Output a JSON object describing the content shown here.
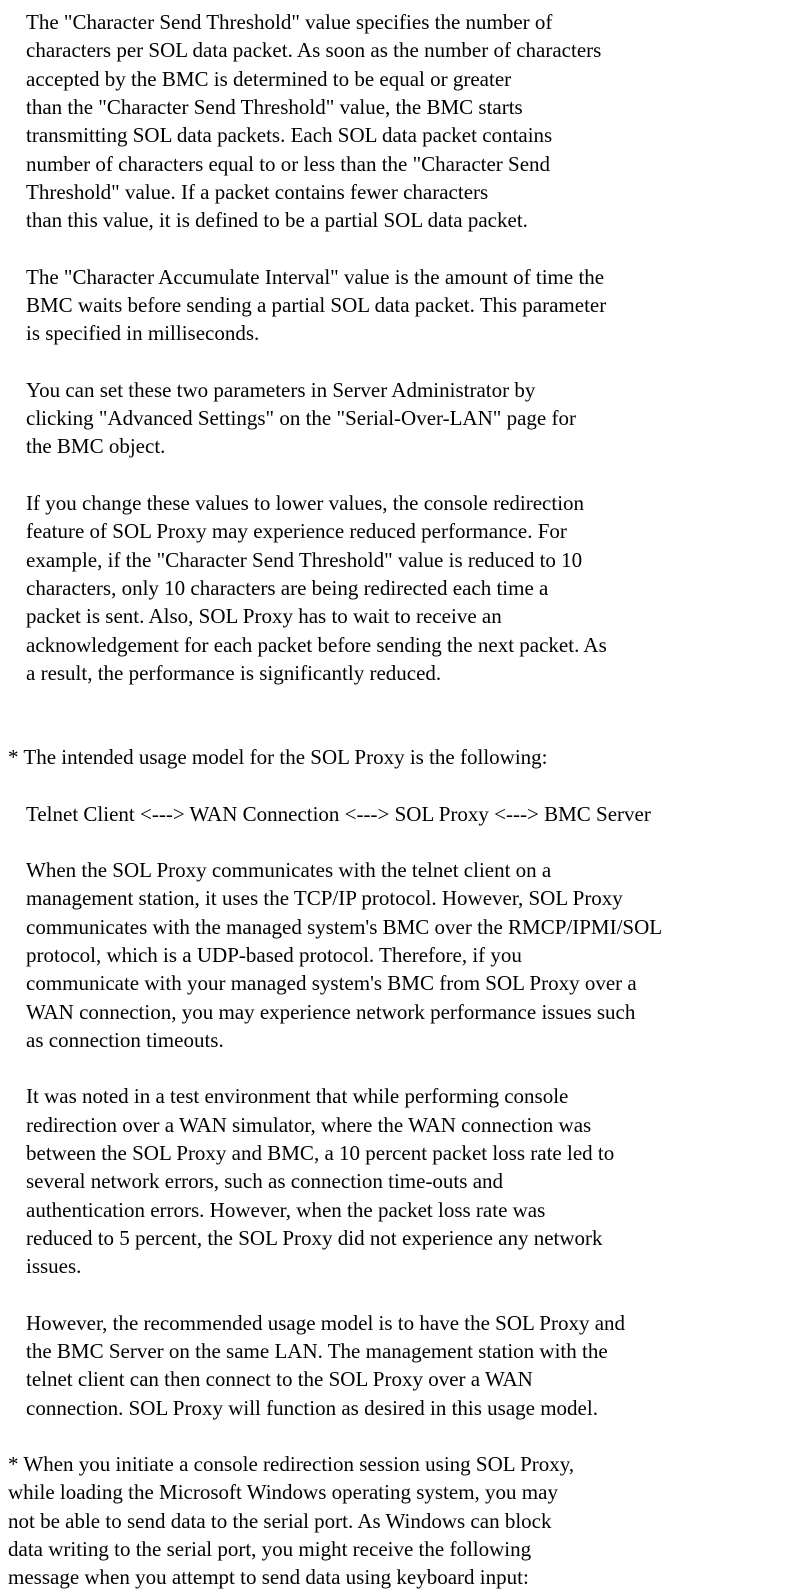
{
  "p1": {
    "l1": "The \"Character Send Threshold\" value specifies the number of",
    "l2": "characters per SOL data packet. As soon as the number of characters",
    "l3": "accepted by the BMC is determined to be equal or greater",
    "l4": "than the \"Character Send Threshold\" value, the BMC starts",
    "l5": "transmitting SOL data packets. Each SOL data packet contains",
    "l6": "number of characters equal to or less than the \"Character Send",
    "l7": "Threshold\" value. If a packet contains fewer characters",
    "l8": "than this value, it is defined to be a partial SOL data packet."
  },
  "p2": {
    "l1": "The \"Character Accumulate Interval\" value is the amount of time the",
    "l2": "BMC waits before sending a partial SOL data packet. This parameter",
    "l3": "is specified in milliseconds."
  },
  "p3": {
    "l1": "You can set these two parameters in Server Administrator by",
    "l2": "clicking \"Advanced Settings\" on the \"Serial-Over-LAN\" page for",
    "l3": "the BMC object."
  },
  "p4": {
    "l1": "If you change these values to lower values, the console redirection",
    "l2": "feature of SOL Proxy may experience reduced performance. For",
    "l3": "example, if the \"Character Send Threshold\" value is reduced to 10",
    "l4": "characters, only 10 characters are being redirected each time a",
    "l5": "packet is sent. Also, SOL Proxy has to wait to receive an",
    "l6": "acknowledgement for each packet before sending the next packet. As",
    "l7": "a result, the performance is significantly reduced."
  },
  "b1": {
    "l1": "* The intended usage model for the SOL Proxy is the following:"
  },
  "p5": {
    "l1": "Telnet Client <---> WAN Connection <---> SOL Proxy <---> BMC Server"
  },
  "p6": {
    "l1": "When the SOL Proxy communicates with the telnet client on a",
    "l2": "management station, it uses the TCP/IP protocol. However, SOL Proxy",
    "l3": "communicates with the managed system's BMC over the RMCP/IPMI/SOL",
    "l4": "protocol, which is a UDP-based protocol. Therefore, if you",
    "l5": "communicate with your managed system's BMC from SOL Proxy over a",
    "l6": "WAN connection, you may experience network performance issues such",
    "l7": "as connection timeouts."
  },
  "p7": {
    "l1": "It was noted in a test environment that while performing console",
    "l2": "redirection over a WAN simulator, where the WAN connection was",
    "l3": "between the SOL Proxy and BMC, a 10 percent packet loss rate led to",
    "l4": "several network errors, such as connection time-outs and",
    "l5": "authentication errors. However, when the packet loss rate was",
    "l6": "reduced to 5 percent, the SOL Proxy did not experience any network",
    "l7": "issues."
  },
  "p8": {
    "l1": "However, the recommended usage model is to have the SOL Proxy and",
    "l2": "the BMC Server on the same LAN. The management station with the",
    "l3": "telnet client can then connect to the SOL Proxy over a WAN",
    "l4": "connection. SOL Proxy will function as desired in this usage model."
  },
  "b2": {
    "l1": "* When you initiate a console redirection session using SOL Proxy,",
    "l2": "   while loading the Microsoft Windows operating system, you may",
    "l3": "   not be able to send data to the serial port. As Windows can block",
    "l4": "   data writing to the serial port, you might receive the following",
    "l5": "   message when you attempt to send data using keyboard input:"
  }
}
